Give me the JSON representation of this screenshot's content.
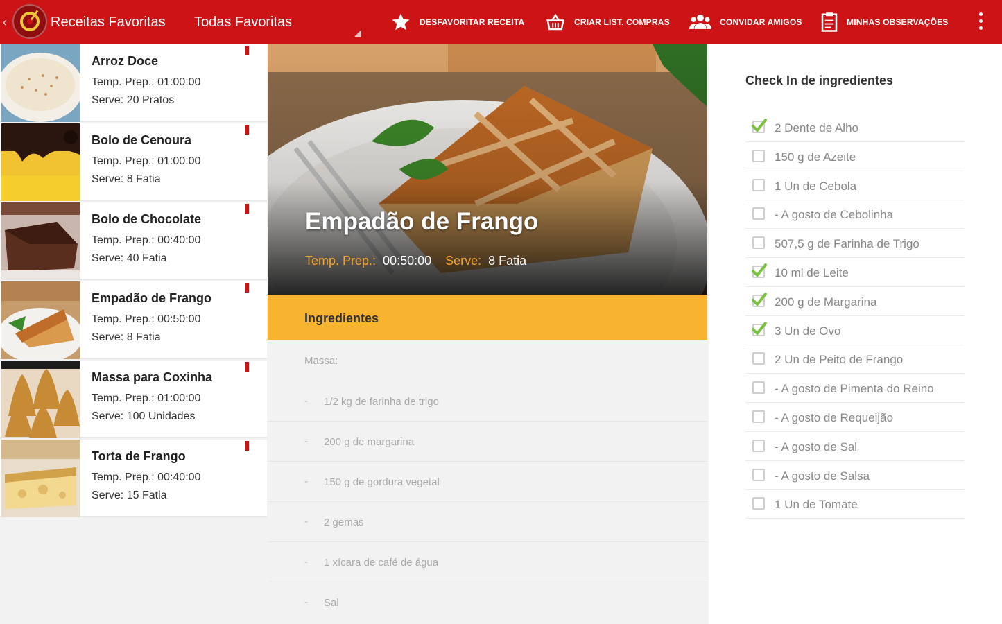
{
  "topbar": {
    "app_title": "Receitas Favoritas",
    "spinner_value": "Todas Favoritas",
    "actions": [
      {
        "label": "DESFAVORITAR RECEITA",
        "icon": "star-icon"
      },
      {
        "label": "CRIAR LIST. COMPRAS",
        "icon": "basket-icon"
      },
      {
        "label": "CONVIDAR AMIGOS",
        "icon": "group-icon"
      },
      {
        "label": "MINHAS OBSERVAÇÕES",
        "icon": "notes-icon"
      }
    ]
  },
  "recipes": [
    {
      "name": "Arroz Doce",
      "prep_label": "Temp. Prep.:",
      "prep": "01:00:00",
      "serve_label": "Serve:",
      "serve": "20 Pratos"
    },
    {
      "name": "Bolo de Cenoura",
      "prep_label": "Temp. Prep.:",
      "prep": "01:00:00",
      "serve_label": "Serve:",
      "serve": "8 Fatia"
    },
    {
      "name": "Bolo de Chocolate",
      "prep_label": "Temp. Prep.:",
      "prep": "00:40:00",
      "serve_label": "Serve:",
      "serve": "40 Fatia"
    },
    {
      "name": "Empadão de Frango",
      "prep_label": "Temp. Prep.:",
      "prep": "00:50:00",
      "serve_label": "Serve:",
      "serve": "8 Fatia"
    },
    {
      "name": "Massa para Coxinha",
      "prep_label": "Temp. Prep.:",
      "prep": "01:00:00",
      "serve_label": "Serve:",
      "serve": "100 Unidades"
    },
    {
      "name": "Torta de Frango",
      "prep_label": "Temp. Prep.:",
      "prep": "00:40:00",
      "serve_label": "Serve:",
      "serve": "15 Fatia"
    }
  ],
  "detail": {
    "title": "Empadão de Frango",
    "prep_label": "Temp. Prep.:",
    "prep": "00:50:00",
    "serve_label": "Serve:",
    "serve": "8 Fatia",
    "ingredients_header": "Ingredientes",
    "group_label": "Massa:",
    "ingredients": [
      "1/2 kg de farinha de trigo",
      "200 g de margarina",
      "150 g de gordura vegetal",
      "2 gemas",
      "1 xícara de café de água",
      "Sal"
    ],
    "dash": "-"
  },
  "checklist": {
    "title": "Check In de ingredientes",
    "items": [
      {
        "text": "2 Dente de Alho",
        "checked": true
      },
      {
        "text": "150 g de Azeite",
        "checked": false
      },
      {
        "text": "1 Un de Cebola",
        "checked": false
      },
      {
        "text": "- A gosto de Cebolinha",
        "checked": false
      },
      {
        "text": "507,5 g de Farinha de Trigo",
        "checked": false
      },
      {
        "text": "10 ml de Leite",
        "checked": true
      },
      {
        "text": "200 g de Margarina",
        "checked": true
      },
      {
        "text": "3 Un de Ovo",
        "checked": true
      },
      {
        "text": "2 Un de Peito de Frango",
        "checked": false
      },
      {
        "text": "- A gosto de Pimenta do Reino",
        "checked": false
      },
      {
        "text": "- A gosto de Requeijão",
        "checked": false
      },
      {
        "text": "- A gosto de Sal",
        "checked": false
      },
      {
        "text": "- A gosto de Salsa",
        "checked": false
      },
      {
        "text": "1 Un de Tomate",
        "checked": false
      }
    ]
  },
  "colors": {
    "primary": "#cc1417",
    "accent": "#f8b42e",
    "check": "#7cc242",
    "meta_label": "#f3a52b"
  }
}
